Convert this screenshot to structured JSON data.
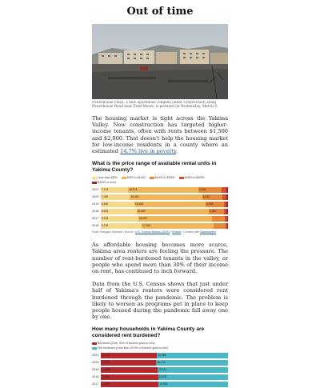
{
  "article": {
    "title": "Out of time",
    "photo_caption": "Powerhouse Plaza, a new apartment complex under construction along Powerhouse Road near Fred Meyer, is pictured on Wednesday, March 8, 2023, in Yakima, Wash.",
    "para1_text": "The housing market is tight across the Yakima Valley. New construction has targeted higher-income tenants, often with rents between $1,500 and $2,000. That doesn't help the housing market for low-income residents in a county where an estimated",
    "para1_link": "14.7% live in poverty",
    "para1_end": ".",
    "para2": "As affordable housing becomes more scarce, Yakima area renters are feeling the pressure. The number of rent-burdened tenants in the valley, or people who spend more than 30% of their income on rent, has continued to inch forward.",
    "para3": "Data from the U.S. Census shows that just under half of Yakima's renters were considered rent burdened through the pandemic. The problem is likely to worsen as programs put in place to keep people housed during the pandemic fall away one by one."
  },
  "charts": {
    "rent": {
      "heading": "What is the price range of available rental units in Yakima County?",
      "note_prefix": "Chart: Margaux Maxwell • Source:",
      "note_source": "U.S. Census Bureau (2021)",
      "note_mid": "•",
      "note_embed": "Embed",
      "note_tool": "• Created with",
      "note_dw": "Datawrapper"
    },
    "burden": {
      "heading": "How many households in Yakima County are considered rent burdened?"
    }
  },
  "chart_data": [
    {
      "type": "bar",
      "stacked": true,
      "title": "What is the price range of available rental units in Yakima County?",
      "categories": [
        "2021",
        "2020",
        "2019",
        "2018",
        "2017",
        "2016"
      ],
      "series": [
        {
          "name": "Less than $500",
          "color": "#f5d889",
          "values": [
            7178,
            7390,
            8639,
            8904,
            9193,
            9790
          ]
        },
        {
          "name": "$500 to $1000",
          "color": "#f0b75a",
          "values": [
            18573,
            18426,
            18468,
            18089,
            18093,
            17320
          ]
        },
        {
          "name": "$1000 to $1500",
          "color": "#e68a3a",
          "values": [
            5994,
            5218,
            4560,
            3902,
            3312,
            2780
          ]
        },
        {
          "name": "$1500 to $2000",
          "color": "#d24d35",
          "values": [
            1210,
            950,
            780,
            600,
            480,
            420
          ]
        },
        {
          "name": "$2000 or more",
          "color": "#9a2232",
          "values": [
            520,
            430,
            350,
            300,
            240,
            200
          ]
        }
      ]
    },
    {
      "type": "bar",
      "stacked": true,
      "title": "How many households in Yakima County are considered rent burdened?",
      "categories": [
        "2021",
        "2020",
        "2019",
        "2018",
        "2017"
      ],
      "series": [
        {
          "name": "Burdened (Over 30% of income goes to rent)",
          "color": "#b5292e",
          "values": [
            12772,
            12446,
            12388,
            12341,
            12500
          ]
        },
        {
          "name": "Not burdened (Less than 29.9% of income goes to rent)",
          "color": "#4ab7c4",
          "values": [
            16088,
            16174,
            15321,
            15097,
            15000
          ]
        }
      ]
    }
  ]
}
